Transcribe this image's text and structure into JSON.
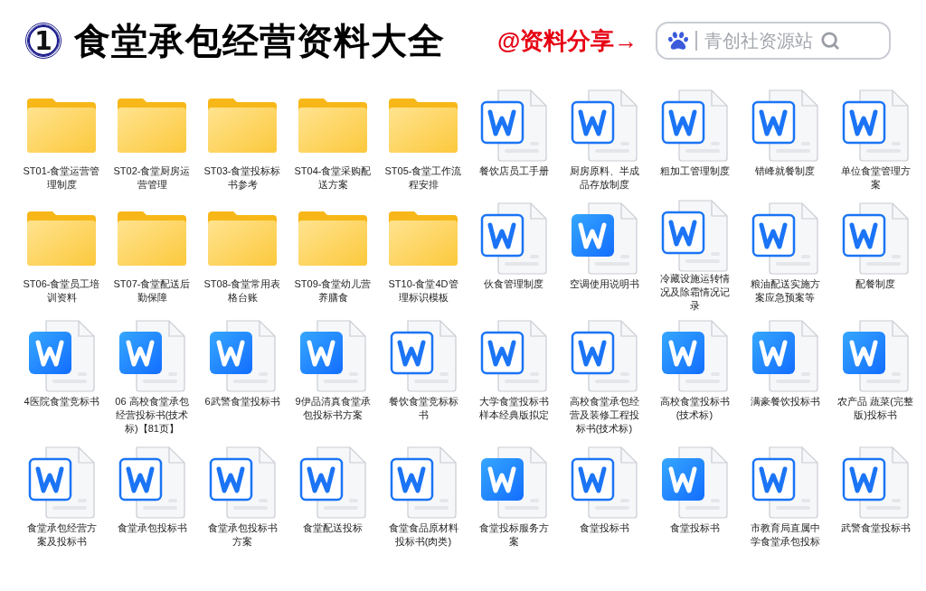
{
  "title": {
    "number": "1",
    "text": "食堂承包经营资料大全"
  },
  "share_label": "@资料分享→",
  "search": {
    "placeholder": "青创社资源站"
  },
  "items": [
    {
      "kind": "folder",
      "name": "ST01-食堂运营管理制度"
    },
    {
      "kind": "folder",
      "name": "ST02-食堂厨房运营管理"
    },
    {
      "kind": "folder",
      "name": "ST03-食堂投标标书参考"
    },
    {
      "kind": "folder",
      "name": "ST04-食堂采购配送方案"
    },
    {
      "kind": "folder",
      "name": "ST05-食堂工作流程安排"
    },
    {
      "kind": "doc_outline",
      "name": "餐饮店员工手册"
    },
    {
      "kind": "doc_outline",
      "name": "厨房原料、半成品存放制度"
    },
    {
      "kind": "doc_outline",
      "name": "粗加工管理制度"
    },
    {
      "kind": "doc_outline",
      "name": "错峰就餐制度"
    },
    {
      "kind": "doc_outline",
      "name": "单位食堂管理方案"
    },
    {
      "kind": "folder",
      "name": "ST06-食堂员工培训资料"
    },
    {
      "kind": "folder",
      "name": "ST07-食堂配送后勤保障"
    },
    {
      "kind": "folder",
      "name": "ST08-食堂常用表格台账"
    },
    {
      "kind": "folder",
      "name": "ST09-食堂幼儿营养膳食"
    },
    {
      "kind": "folder",
      "name": "ST10-食堂4D管理标识模板"
    },
    {
      "kind": "doc_outline",
      "name": "伙食管理制度"
    },
    {
      "kind": "doc_filled",
      "name": "空调使用说明书"
    },
    {
      "kind": "doc_outline",
      "name": "冷藏设施运转情况及除霜情况记录"
    },
    {
      "kind": "doc_outline",
      "name": "粮油配送实施方案应急预案等"
    },
    {
      "kind": "doc_outline",
      "name": "配餐制度"
    },
    {
      "kind": "doc_filled",
      "name": "4医院食堂竞标书"
    },
    {
      "kind": "doc_filled",
      "name": "06 高校食堂承包经营投标书(技术标)【81页】"
    },
    {
      "kind": "doc_filled",
      "name": "6武警食堂投标书"
    },
    {
      "kind": "doc_filled",
      "name": "9伊品清真食堂承包投标书方案"
    },
    {
      "kind": "doc_outline",
      "name": "餐饮食堂竞标标书"
    },
    {
      "kind": "doc_outline",
      "name": "大学食堂投标书样本经典版拟定"
    },
    {
      "kind": "doc_outline",
      "name": "高校食堂承包经营及装修工程投标书(技术标)"
    },
    {
      "kind": "doc_filled",
      "name": "高校食堂投标书(技术标)"
    },
    {
      "kind": "doc_filled",
      "name": "满豪餐饮投标书"
    },
    {
      "kind": "doc_filled",
      "name": "农产品 蔬菜(完整版)投标书"
    },
    {
      "kind": "doc_outline",
      "name": "食堂承包经营方案及投标书"
    },
    {
      "kind": "doc_outline",
      "name": "食堂承包投标书"
    },
    {
      "kind": "doc_outline",
      "name": "食堂承包投标书方案"
    },
    {
      "kind": "doc_outline",
      "name": "食堂配送投标"
    },
    {
      "kind": "doc_outline",
      "name": "食堂食品原材料投标书(肉类)"
    },
    {
      "kind": "doc_filled",
      "name": "食堂投标服务方案"
    },
    {
      "kind": "doc_outline",
      "name": "食堂投标书"
    },
    {
      "kind": "doc_filled",
      "name": "食堂投标书"
    },
    {
      "kind": "doc_outline",
      "name": "市教育局直属中学食堂承包投标"
    },
    {
      "kind": "doc_outline",
      "name": "武警食堂投标书"
    }
  ]
}
